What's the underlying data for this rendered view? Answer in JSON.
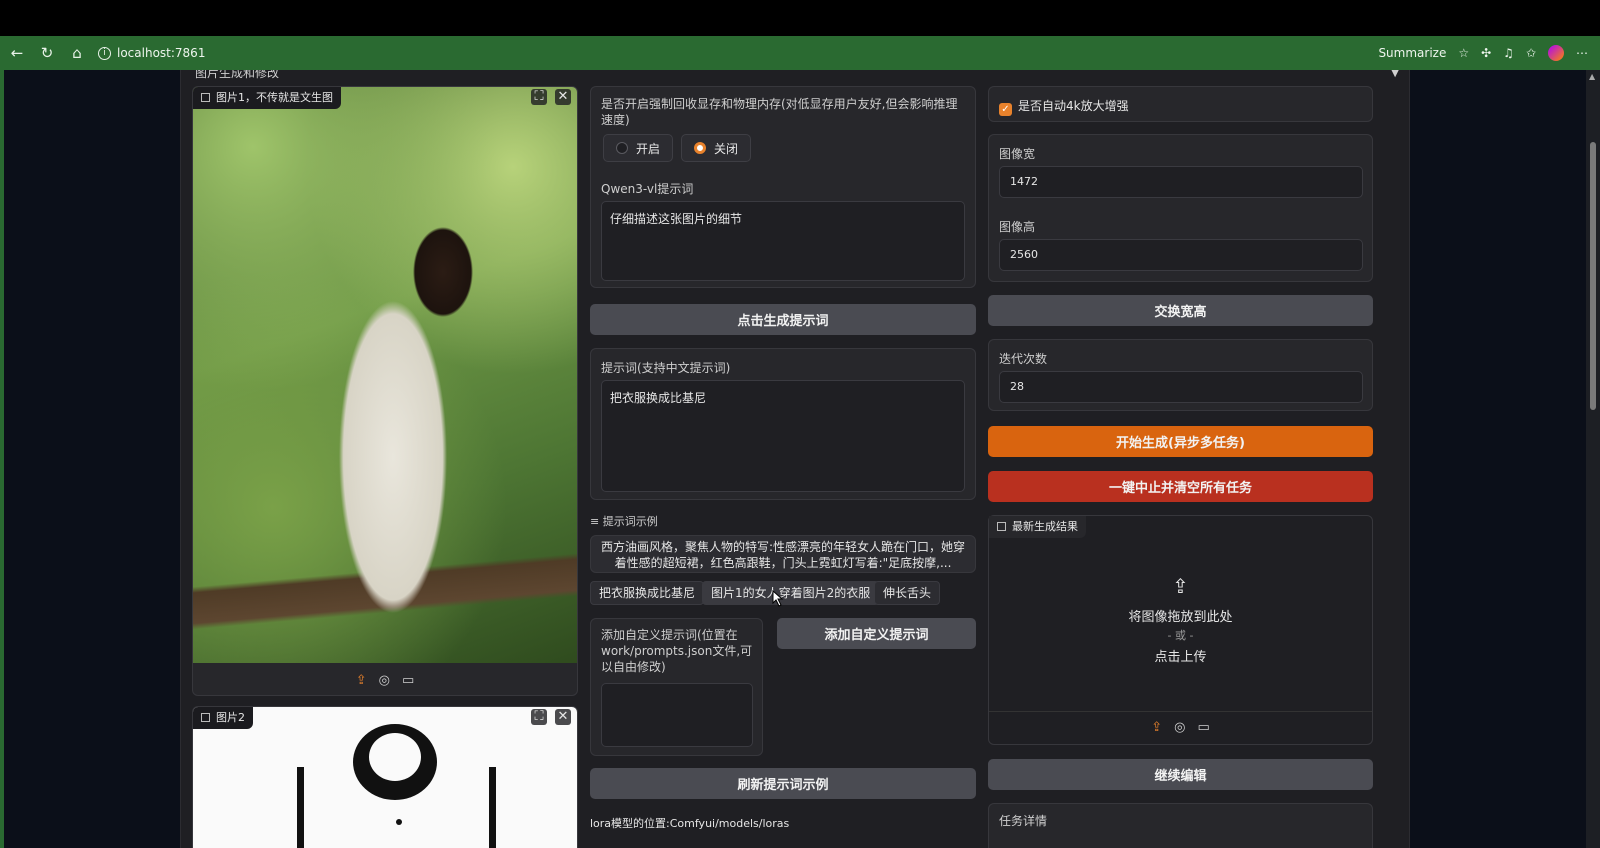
{
  "browser": {
    "url": "localhost:7861",
    "summarize_label": "Summarize"
  },
  "accordion": {
    "title": "图片生成和修改"
  },
  "image1": {
    "label": "图片1，不传就是文生图"
  },
  "image2": {
    "label": "图片2"
  },
  "memory": {
    "label": "是否开启强制回收显存和物理内存(对低显存用户友好,但会影响推理速度)",
    "options": [
      "开启",
      "关闭"
    ],
    "selected": "关闭"
  },
  "qwen": {
    "label": "Qwen3-vl提示词",
    "value": "仔细描述这张图片的细节"
  },
  "gen_prompt_button": "点击生成提示词",
  "prompt": {
    "label": "提示词(支持中文提示词)",
    "value": "把衣服换成比基尼"
  },
  "examples": {
    "label": "提示词示例",
    "long_example": "西方油画风格，聚焦人物的特写:性感漂亮的年轻女人跪在门口，她穿着性感的超短裙，红色高跟鞋，门头上霓虹灯写着:\"足底按摩,...",
    "chips": [
      "把衣服换成比基尼",
      "图片1的女人穿着图片2的衣服",
      "伸长舌头"
    ]
  },
  "custom": {
    "label": "添加自定义提示词(位置在work/prompts.json文件,可以自由修改)",
    "value": "",
    "button": "添加自定义提示词"
  },
  "refresh_button": "刷新提示词示例",
  "lora_note": "lora模型的位置:Comfyui/models/loras",
  "upscale": {
    "label": "是否自动4k放大增强",
    "checked": true
  },
  "width": {
    "label": "图像宽",
    "value": "1472"
  },
  "height": {
    "label": "图像高",
    "value": "2560"
  },
  "swap_button": "交换宽高",
  "steps": {
    "label": "迭代次数",
    "value": "28"
  },
  "start_button": "开始生成(异步多任务)",
  "stop_button": "一键中止并清空所有任务",
  "result": {
    "label": "最新生成结果",
    "drop_text": "将图像拖放到此处",
    "or_text": "- 或 -",
    "click_text": "点击上传"
  },
  "continue_button": "继续编辑",
  "task_details_label": "任务详情",
  "colors": {
    "browser_bar": "#2a6a31",
    "accent_orange": "#d9640f",
    "danger_red": "#b9301f",
    "panel_bg": "#1f1f23"
  }
}
